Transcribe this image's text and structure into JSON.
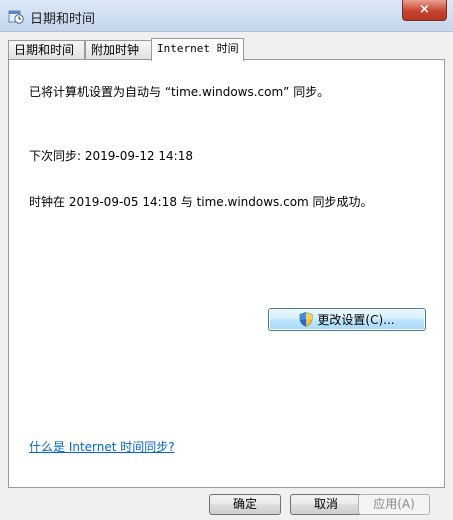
{
  "window": {
    "title": "日期和时间",
    "close_label": "×",
    "icon": "clock-calendar-icon"
  },
  "tabs": [
    {
      "label": "日期和时间"
    },
    {
      "label": "附加时钟"
    },
    {
      "label": "Internet 时间",
      "active": true
    }
  ],
  "panel": {
    "sync_status": "已将计算机设置为自动与 “time.windows.com” 同步。",
    "next_sync": "下次同步: 2019-09-12 14:18",
    "last_sync": "时钟在 2019-09-05 14:18 与 time.windows.com 同步成功。",
    "change_settings_label": "更改设置(C)...",
    "help_link": "什么是 Internet 时间同步?"
  },
  "buttons": {
    "ok": "确定",
    "cancel": "取消",
    "apply": "应用(A)"
  },
  "colors": {
    "link": "#0066cc",
    "accent_button_border": "#3c7fb1"
  }
}
